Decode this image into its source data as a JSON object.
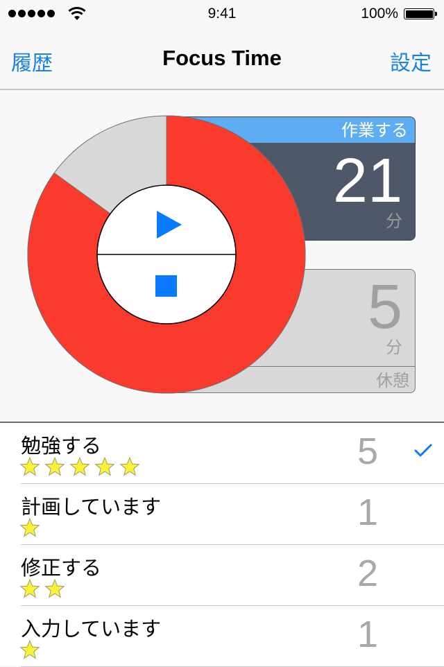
{
  "status_bar": {
    "signal_bars": 5,
    "time": "9:41",
    "battery_percent": "100%",
    "battery_level": 1.0
  },
  "nav": {
    "left_label": "履歴",
    "title": "Focus Time",
    "right_label": "設定"
  },
  "timer": {
    "progress_elapsed_fraction": 0.85,
    "colors": {
      "elapsed": "#fa3a2d",
      "remaining": "#d8d8d8",
      "accent": "#0a7aff"
    },
    "play_icon": "play-icon",
    "stop_icon": "stop-icon"
  },
  "work_card": {
    "label": "作業する",
    "value": "21",
    "unit": "分"
  },
  "break_card": {
    "label": "休憩",
    "value": "5",
    "unit": "分"
  },
  "tasks": [
    {
      "name": "勉強する",
      "stars": 5,
      "count": "5",
      "selected": true
    },
    {
      "name": "計画しています",
      "stars": 1,
      "count": "1",
      "selected": false
    },
    {
      "name": "修正する",
      "stars": 2,
      "count": "2",
      "selected": false
    },
    {
      "name": "入力しています",
      "stars": 1,
      "count": "1",
      "selected": false
    }
  ]
}
